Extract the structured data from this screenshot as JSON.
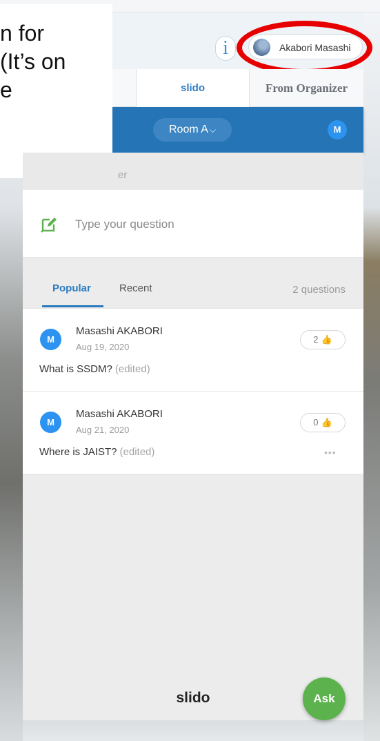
{
  "overlay": {
    "text": "n for\n(It’s on\ne"
  },
  "header": {
    "info_icon": "i",
    "user_name": "Akabori Masashi"
  },
  "tabs": [
    {
      "label": "slido"
    },
    {
      "label": "From Organizer"
    }
  ],
  "room": {
    "name": "Room A",
    "chevron": "⌵",
    "avatar_initial": "M"
  },
  "speaker_partial": "er",
  "ask": {
    "placeholder": "Type your question",
    "icon": "compose-icon"
  },
  "questions_header": {
    "tabs": [
      "Popular",
      "Recent"
    ],
    "count": "2 questions"
  },
  "questions": [
    {
      "initial": "M",
      "author": "Masashi AKABORI",
      "date": "Aug 19, 2020",
      "text": "What is SSDM?",
      "edited": "(edited)",
      "likes": "2"
    },
    {
      "initial": "M",
      "author": "Masashi AKABORI",
      "date": "Aug 21, 2020",
      "text": "Where is JAIST?",
      "edited": "(edited)",
      "likes": "0",
      "more": "•••"
    }
  ],
  "footer": {
    "logo": "slido",
    "ask_button": "Ask"
  },
  "colors": {
    "brand_blue": "#2574b5",
    "accent_green": "#5cb34e",
    "highlight_red": "#e60000"
  }
}
